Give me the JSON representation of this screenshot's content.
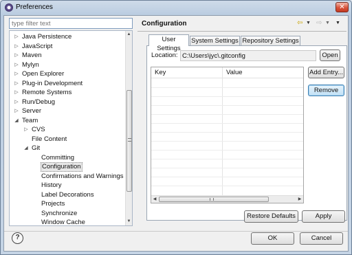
{
  "window": {
    "title": "Preferences",
    "close_glyph": "✕",
    "icon": "eclipse-icon"
  },
  "filter": {
    "placeholder": "type filter text"
  },
  "tree": [
    {
      "label": "Java Persistence",
      "level": 0,
      "state": "collapsed"
    },
    {
      "label": "JavaScript",
      "level": 0,
      "state": "collapsed"
    },
    {
      "label": "Maven",
      "level": 0,
      "state": "collapsed"
    },
    {
      "label": "Mylyn",
      "level": 0,
      "state": "collapsed"
    },
    {
      "label": "Open Explorer",
      "level": 0,
      "state": "collapsed"
    },
    {
      "label": "Plug-in Development",
      "level": 0,
      "state": "collapsed"
    },
    {
      "label": "Remote Systems",
      "level": 0,
      "state": "collapsed"
    },
    {
      "label": "Run/Debug",
      "level": 0,
      "state": "collapsed"
    },
    {
      "label": "Server",
      "level": 0,
      "state": "collapsed"
    },
    {
      "label": "Team",
      "level": 0,
      "state": "expanded"
    },
    {
      "label": "CVS",
      "level": 1,
      "state": "collapsed"
    },
    {
      "label": "File Content",
      "level": 1,
      "state": "leaf"
    },
    {
      "label": "Git",
      "level": 1,
      "state": "expanded"
    },
    {
      "label": "Committing",
      "level": 2,
      "state": "leaf"
    },
    {
      "label": "Configuration",
      "level": 2,
      "state": "leaf",
      "selected": true
    },
    {
      "label": "Confirmations and Warnings",
      "level": 2,
      "state": "leaf"
    },
    {
      "label": "History",
      "level": 2,
      "state": "leaf"
    },
    {
      "label": "Label Decorations",
      "level": 2,
      "state": "leaf"
    },
    {
      "label": "Projects",
      "level": 2,
      "state": "leaf"
    },
    {
      "label": "Synchronize",
      "level": 2,
      "state": "leaf"
    },
    {
      "label": "Window Cache",
      "level": 2,
      "state": "leaf"
    }
  ],
  "page": {
    "title": "Configuration",
    "nav": {
      "back": "⇦",
      "forward": "⇨",
      "dropdown": "▼"
    }
  },
  "tabs": [
    {
      "label": "User Settings",
      "active": true
    },
    {
      "label": "System Settings",
      "active": false
    },
    {
      "label": "Repository Settings",
      "active": false
    }
  ],
  "location": {
    "label": "Location:",
    "value": "C:\\Users\\jyc\\.gitconfig",
    "open_label": "Open"
  },
  "table": {
    "columns": [
      "Key",
      "Value"
    ],
    "rows": []
  },
  "actions": {
    "add_entry": "Add Entry...",
    "remove": "Remove"
  },
  "footer": {
    "restore_defaults": "Restore Defaults",
    "apply": "Apply",
    "ok": "OK",
    "cancel": "Cancel",
    "help_glyph": "?"
  },
  "colors": {
    "title_gradient": "#b9cbe0",
    "close_red": "#d8533b",
    "focus_blue": "#3c7fb1"
  }
}
